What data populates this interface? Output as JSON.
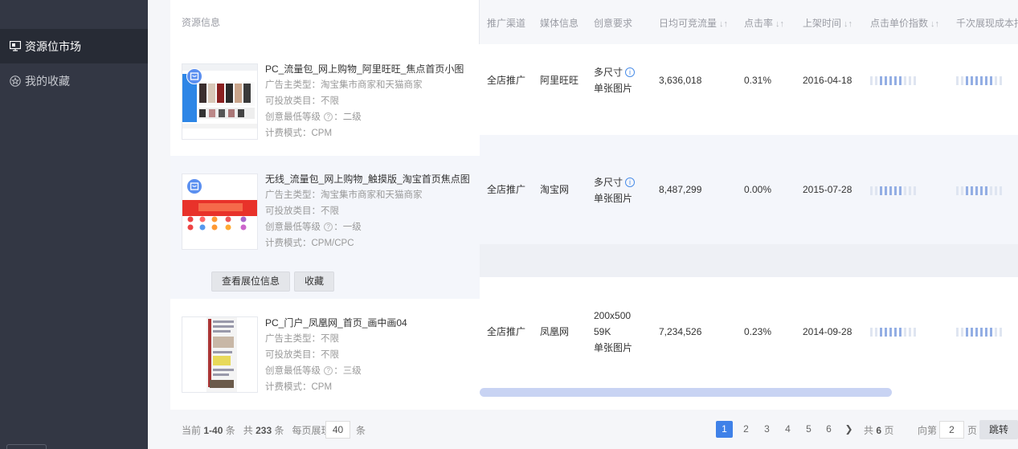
{
  "sidebar": {
    "items": [
      {
        "label": "资源位市场",
        "icon": "monitor-icon",
        "active": true
      },
      {
        "label": "我的收藏",
        "icon": "star-icon",
        "active": false
      }
    ]
  },
  "table": {
    "left_header": "资源信息",
    "headers": [
      "推广渠道",
      "媒体信息",
      "创意要求",
      "日均可竞流量",
      "点击率",
      "上架时间",
      "点击单价指数",
      "千次展现成本指"
    ],
    "resources": [
      {
        "title": "PC_流量包_网上购物_阿里旺旺_焦点首页小图",
        "advertiser": "广告主类型：淘宝集市商家和天猫商家",
        "category": "可投放类目：不限",
        "level_prefix": "创意最低等级",
        "level_value": "：二级",
        "billing": "计费模式：CPM",
        "channel": "全店推广",
        "media": "阿里旺旺",
        "creative": [
          "多尺寸",
          "单张图片"
        ],
        "traffic": "3,636,018",
        "ctr": "0.31%",
        "date": "2016-04-18",
        "cpc_index": 0.5,
        "cpm_index": 0.6
      },
      {
        "title": "无线_流量包_网上购物_触摸版_淘宝首页焦点图",
        "advertiser": "广告主类型：淘宝集市商家和天猫商家",
        "category": "可投放类目：不限",
        "level_prefix": "创意最低等级",
        "level_value": "：一级",
        "billing": "计费模式：CPM/CPC",
        "channel": "全店推广",
        "media": "淘宝网",
        "creative": [
          "多尺寸",
          "单张图片"
        ],
        "traffic": "8,487,299",
        "ctr": "0.00%",
        "date": "2015-07-28",
        "cpc_index": 0.5,
        "cpm_index": 0.5
      },
      {
        "title": "PC_门户_凤凰网_首页_画中画04",
        "advertiser": "广告主类型：不限",
        "category": "可投放类目：不限",
        "level_prefix": "创意最低等级",
        "level_value": "：三级",
        "billing": "计费模式：CPM",
        "channel": "全店推广",
        "media": "凤凰网",
        "creative": [
          "200x500",
          "59K",
          "单张图片"
        ],
        "traffic": "7,234,526",
        "ctr": "0.23%",
        "date": "2014-09-28",
        "cpc_index": 0.5,
        "cpm_index": 0.6
      }
    ],
    "actions": {
      "view": "查看展位信息",
      "favorite": "收藏"
    }
  },
  "footer": {
    "current_prefix": "当前",
    "current_range": "1-40",
    "unit_tiao": "条",
    "total_prefix": "共",
    "total": "233",
    "per_page_label": "每页展现",
    "per_page": "40",
    "pages": [
      "1",
      "2",
      "3",
      "4",
      "5",
      "6"
    ],
    "current_page": "1",
    "next": "❯",
    "total_pages_prefix": "共",
    "total_pages": "6",
    "page_unit": "页",
    "goto_label": "向第",
    "goto_value": "2",
    "jump_button": "跳转"
  }
}
